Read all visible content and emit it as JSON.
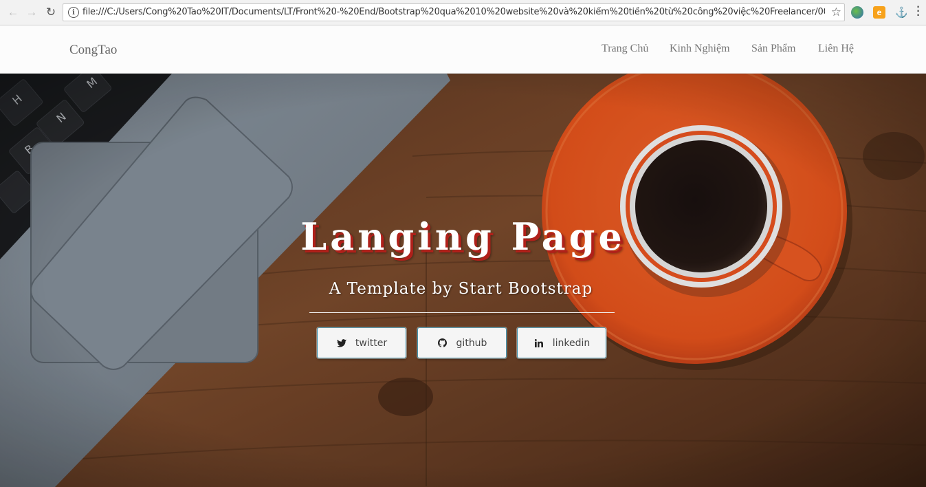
{
  "browser": {
    "url": "file:///C:/Users/Cong%20Tao%20IT/Documents/LT/Front%20-%20End/Bootstrap%20qua%2010%20website%20và%20kiếm%20tiền%20từ%20công%20việc%20Freelancer/004...",
    "info_glyph": "i"
  },
  "navbar": {
    "brand": "CongTao",
    "links": [
      "Trang Chủ",
      "Kinh Nghiệm",
      "Sản Phẩm",
      "Liên Hệ"
    ]
  },
  "hero": {
    "title": "Langing Page",
    "subtitle": "A Template by Start Bootstrap",
    "buttons": [
      {
        "label": "twitter",
        "icon": "twitter-icon"
      },
      {
        "label": "github",
        "icon": "github-icon"
      },
      {
        "label": "linkedin",
        "icon": "linkedin-icon"
      }
    ]
  },
  "colors": {
    "title_shadow": "#b0201a",
    "button_border": "#3a8ea8",
    "saucer": "#e8561f"
  }
}
